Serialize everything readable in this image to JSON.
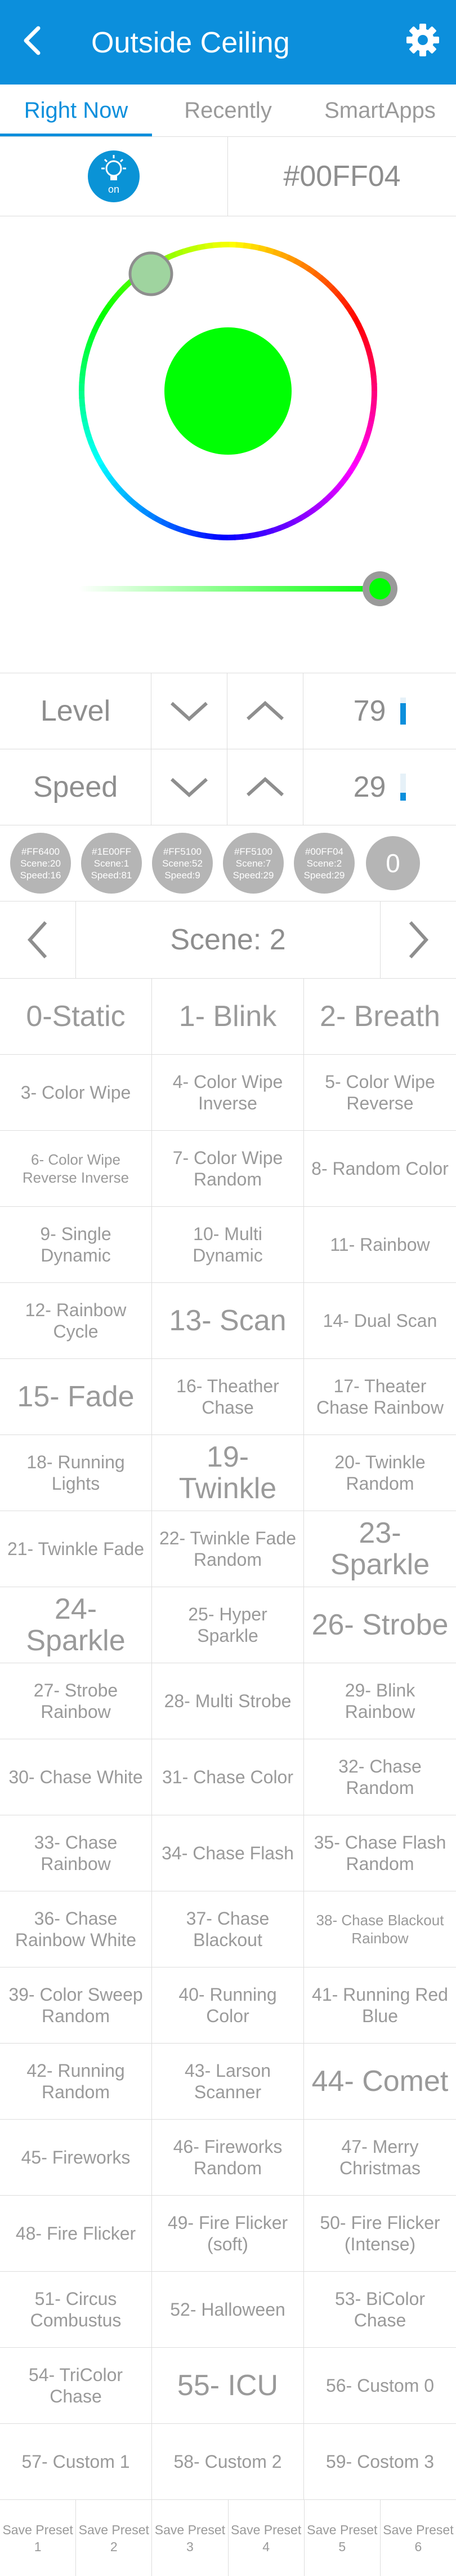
{
  "header": {
    "title": "Outside Ceiling",
    "back_icon": "chevron-left-icon",
    "settings_icon": "gear-icon",
    "bg": "#0c8fdc"
  },
  "tabs": [
    {
      "label": "Right Now",
      "active": true
    },
    {
      "label": "Recently"
    },
    {
      "label": "SmartApps"
    }
  ],
  "power": {
    "label": "on",
    "icon": "bulb-icon"
  },
  "color_hex": "#00FF04",
  "current_color": "#00ff04",
  "brightness_slider_fraction": 0.92,
  "controls": [
    {
      "label": "Level",
      "value": "79",
      "fraction": 0.79
    },
    {
      "label": "Speed",
      "value": "29",
      "fraction": 0.29
    }
  ],
  "scene_chips": [
    [
      "#FF6400",
      "Scene:20",
      "Speed:16"
    ],
    [
      "#1E00FF",
      "Scene:1",
      "Speed:81"
    ],
    [
      "#FF5100",
      "Scene:52",
      "Speed:9"
    ],
    [
      "#FF5100",
      "Scene:7",
      "Speed:29"
    ],
    [
      "#00FF04",
      "Scene:2",
      "Speed:29"
    ]
  ],
  "scene_count": "0",
  "scene_label": "Scene: 2",
  "effects": [
    "0-Static",
    "1- Blink",
    "2- Breath",
    "3- Color Wipe",
    "4- Color Wipe Inverse",
    "5- Color Wipe Reverse",
    "6- Color Wipe Reverse Inverse",
    "7- Color Wipe Random",
    "8- Random Color",
    "9- Single Dynamic",
    "10- Multi Dynamic",
    "11- Rainbow",
    "12- Rainbow Cycle",
    "13- Scan",
    "14- Dual Scan",
    "15- Fade",
    "16- Theather Chase",
    "17- Theater Chase Rainbow",
    "18- Running Lights",
    "19- Twinkle",
    "20- Twinkle Random",
    "21- Twinkle Fade",
    "22- Twinkle Fade Random",
    "23- Sparkle",
    "24- Sparkle",
    "25- Hyper Sparkle",
    "26- Strobe",
    "27- Strobe Rainbow",
    "28- Multi Strobe",
    "29- Blink Rainbow",
    "30- Chase White",
    "31- Chase Color",
    "32- Chase Random",
    "33- Chase Rainbow",
    "34- Chase Flash",
    "35- Chase Flash Random",
    "36- Chase Rainbow White",
    "37- Chase Blackout",
    "38- Chase Blackout Rainbow",
    "39- Color Sweep Random",
    "40- Running Color",
    "41- Running Red Blue",
    "42- Running Random",
    "43- Larson Scanner",
    "44- Comet",
    "45- Fireworks",
    "46- Fireworks Random",
    "47- Merry Christmas",
    "48- Fire Flicker",
    "49- Fire Flicker (soft)",
    "50- Fire Flicker (Intense)",
    "51- Circus Combustus",
    "52- Halloween",
    "53- BiColor Chase",
    "54- TriColor Chase",
    "55- ICU",
    "56- Custom 0",
    "57- Custom 1",
    "58- Custom 2",
    "59- Costom 3"
  ],
  "presets": [
    "Save Preset 1",
    "Save Preset 2",
    "Save Preset 3",
    "Save Preset 4",
    "Save Preset 5",
    "Save Preset 6"
  ]
}
